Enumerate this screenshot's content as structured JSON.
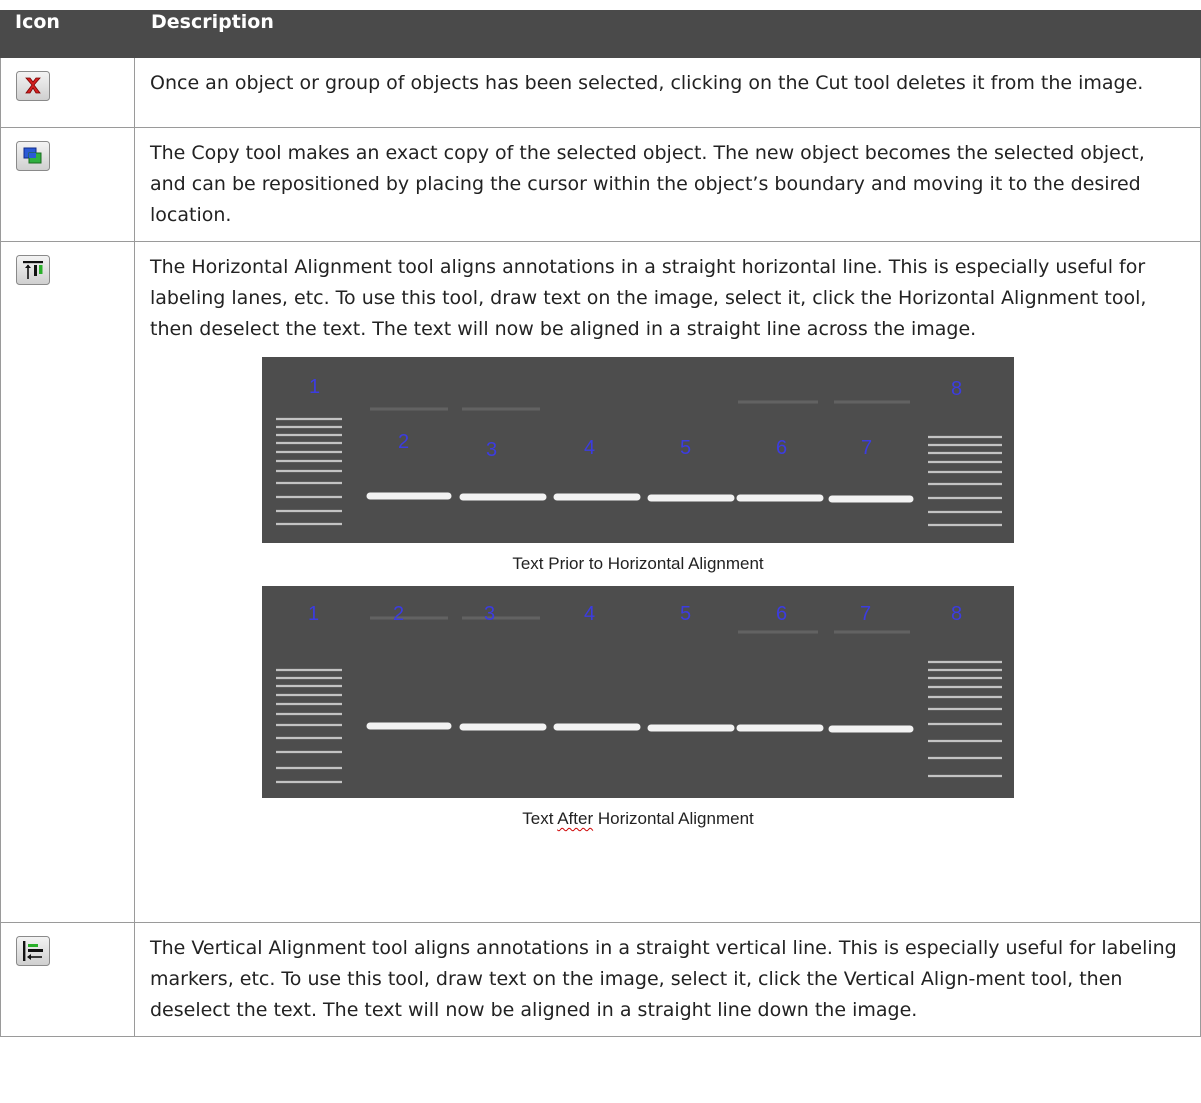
{
  "header": {
    "icon_col": "Icon",
    "description_col": "Description"
  },
  "rows": [
    {
      "icon": "cut-x-icon",
      "text": "Once an object or group of objects has been selected, clicking on the Cut tool deletes it from the image."
    },
    {
      "icon": "copy-icon",
      "text": "The Copy tool makes an exact copy of the selected object. The new object becomes the selected object, and can be repositioned by placing the cursor within the object’s boundary and moving it to the desired location."
    },
    {
      "icon": "horizontal-align-icon",
      "text": "The Horizontal Alignment tool aligns annotations in a straight horizontal line. This is especially useful for labeling lanes, etc. To use this tool, draw text on the image, select it, click the Horizontal Alignment tool, then deselect the text. The text will now be aligned in a straight line across the image.",
      "figures": [
        {
          "lane_labels": [
            "1",
            "2",
            "3",
            "4",
            "5",
            "6",
            "7",
            "8"
          ],
          "caption": "Text Prior to Horizontal Alignment"
        },
        {
          "lane_labels": [
            "1",
            "2",
            "3",
            "4",
            "5",
            "6",
            "7",
            "8"
          ],
          "caption_before": "Text ",
          "caption_flagged": "After",
          "caption_after": " Horizontal Alignment"
        }
      ]
    },
    {
      "icon": "vertical-align-icon",
      "text": "The Vertical Alignment tool aligns annotations in a straight vertical line. This is especially useful for labeling markers, etc. To use this tool, draw text on the image, select it, click the Vertical Align-ment tool, then deselect the text. The text will now be aligned in a straight line down the image."
    }
  ]
}
